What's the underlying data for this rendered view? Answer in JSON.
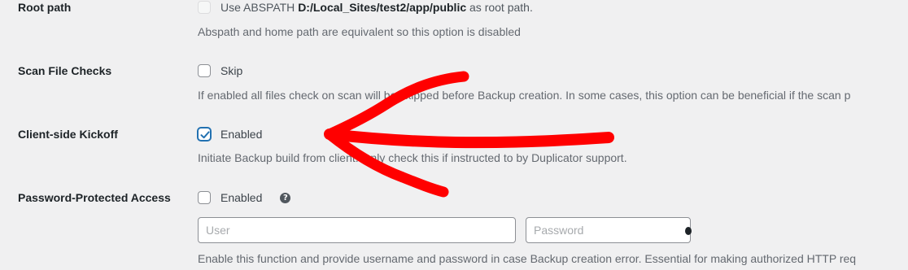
{
  "settings": {
    "root_path": {
      "label": "Root path",
      "option_prefix": "Use ABSPATH",
      "option_path": "D:/Local_Sites/test2/app/public",
      "option_suffix": "as root path.",
      "description": "Abspath and home path are equivalent so this option is disabled",
      "checked": false,
      "disabled": true
    },
    "scan_file_checks": {
      "label": "Scan File Checks",
      "option": "Skip",
      "description": "If enabled all files check on scan will be skipped before Backup creation. In some cases, this option can be beneficial if the scan p",
      "checked": false
    },
    "client_side_kickoff": {
      "label": "Client-side Kickoff",
      "option": "Enabled",
      "description": "Initiate Backup build from client. Only check this if instructed to by Duplicator support.",
      "checked": true
    },
    "password_protected_access": {
      "label": "Password-Protected Access",
      "option": "Enabled",
      "help_icon": "?",
      "user_placeholder": "User",
      "password_placeholder": "Password",
      "description": "Enable this function and provide username and password in case Backup creation error. Essential for making authorized HTTP req",
      "checked": false
    }
  },
  "annotation": {
    "arrow_color": "#ff0000",
    "icon": "hand-drawn-arrow-icon"
  },
  "colors": {
    "background": "#f0f0f1",
    "label": "#1d2327",
    "description": "#646970",
    "checkbox_accent": "#2271b1"
  }
}
